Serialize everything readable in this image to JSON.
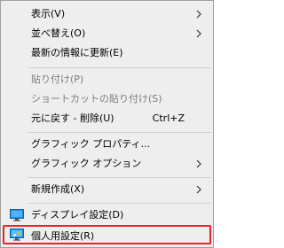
{
  "menu": {
    "items": [
      {
        "label": "表示(V)",
        "submenu": true
      },
      {
        "label": "並べ替え(O)",
        "submenu": true
      },
      {
        "label": "最新の情報に更新(E)"
      },
      {
        "label": "貼り付け(P)",
        "disabled": true
      },
      {
        "label": "ショートカットの貼り付け(S)",
        "disabled": true
      },
      {
        "label": "元に戻す - 削除(U)",
        "shortcut": "Ctrl+Z"
      },
      {
        "label": "グラフィック プロパティ..."
      },
      {
        "label": "グラフィック オプション",
        "submenu": true
      },
      {
        "label": "新規作成(X)",
        "submenu": true
      },
      {
        "label": "ディスプレイ設定(D)",
        "icon": "display-icon"
      },
      {
        "label": "個人用設定(R)",
        "icon": "personalize-icon",
        "highlighted": true
      }
    ]
  },
  "colors": {
    "background": "#eeeeee",
    "highlight_border": "#e3242b",
    "disabled_text": "#7d7d7d"
  }
}
